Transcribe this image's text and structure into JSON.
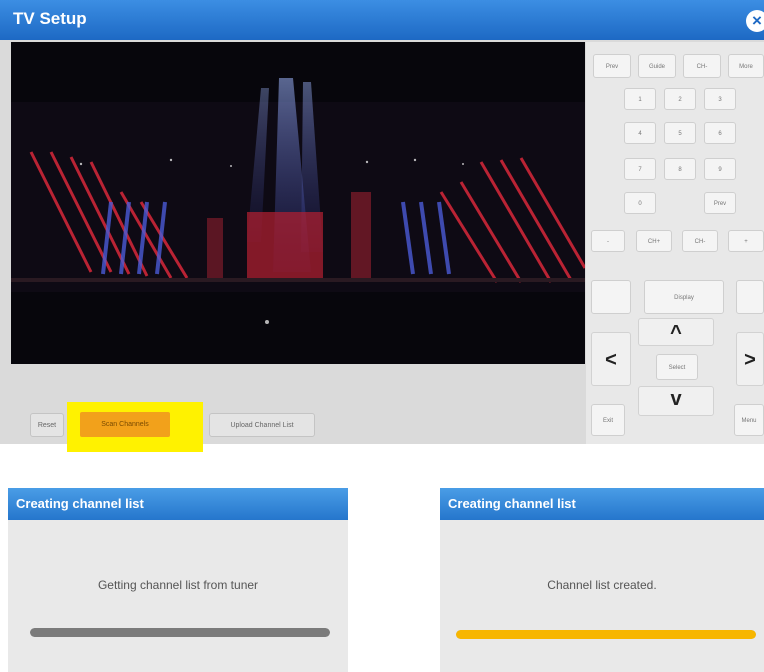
{
  "window": {
    "title": "TV Setup",
    "close_glyph": "×",
    "close_icon": "close-icon",
    "accent": "#1d69c4"
  },
  "actions": {
    "reset_label": "Reset",
    "scan_label": "Scan Channels",
    "upload_label": "Upload Channel List",
    "highlight_color": "#fff200",
    "scan_color": "#f2a11b"
  },
  "remote": {
    "top_row": [
      "Prev",
      "Guide",
      "CH-",
      "More"
    ],
    "digits": [
      "1",
      "2",
      "3",
      "4",
      "5",
      "6",
      "7",
      "8",
      "9"
    ],
    "zero": "0",
    "prev_label": "Prev",
    "mid_row": [
      "-",
      "CH+",
      "CH-",
      "+"
    ],
    "display_label": "Display",
    "select_label": "Select",
    "exit_label": "Exit",
    "menu_label": "Menu",
    "arrows": {
      "up": "^",
      "down": "v",
      "left": "<",
      "right": ">"
    }
  },
  "dialogs": [
    {
      "title": "Creating channel list",
      "message": "Getting channel list from tuner",
      "progress": 1.0,
      "bar_color": "#7b7b7b"
    },
    {
      "title": "Creating channel list",
      "message": "Channel list created.",
      "progress": 1.0,
      "bar_color": "#f7b600"
    }
  ]
}
